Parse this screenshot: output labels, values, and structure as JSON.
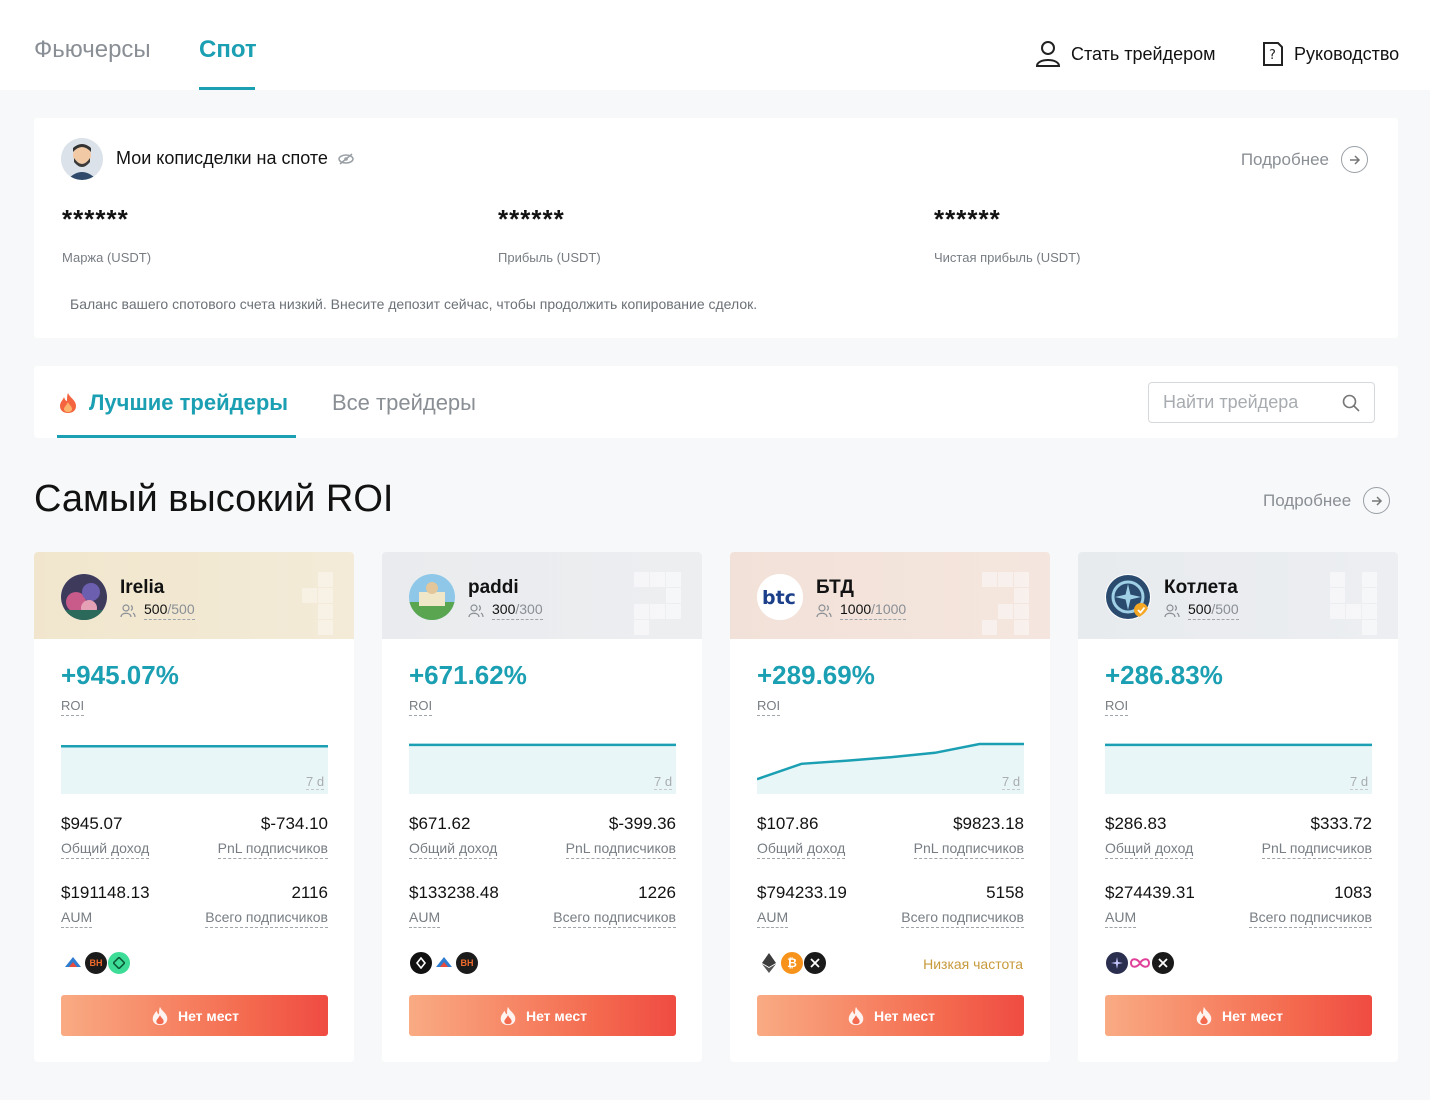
{
  "nav": {
    "tabs": [
      {
        "label": "Фьючерсы"
      },
      {
        "label": "Спот"
      }
    ],
    "become_trader": "Стать трейдером",
    "guide": "Руководство"
  },
  "overview": {
    "title": "Мои копиcделки на споте",
    "more": "Подробнее",
    "stats": [
      {
        "value": "******",
        "label": "Маржа (USDT)"
      },
      {
        "value": "******",
        "label": "Прибыль (USDT)"
      },
      {
        "value": "******",
        "label": "Чистая прибыль (USDT)"
      }
    ],
    "notice": "Баланс вашего спотового счета низкий. Внесите депозит сейчас, чтобы продолжить копирование сделок."
  },
  "tabs": {
    "best": "Лучшие трейдеры",
    "all": "Все трейдеры",
    "search_placeholder": "Найти трейдера"
  },
  "section": {
    "title": "Самый высокий ROI",
    "more": "Подробнее"
  },
  "labels": {
    "roi": "ROI",
    "period": "7 d",
    "total_income": "Общий доход",
    "follower_pnl": "PnL подписчиков",
    "aum": "AUM",
    "total_followers": "Всего подписчиков",
    "no_slots": "Нет мест"
  },
  "traders": [
    {
      "name": "Irelia",
      "slots_used": "500",
      "slots_total": "/500",
      "roi": "+945.07%",
      "total_income": "$945.07",
      "follower_pnl": "$-734.10",
      "aum": "$191148.13",
      "followers": "2116",
      "frequency": "",
      "coins": [
        "arrow-coin-icon",
        "bh-coin-icon",
        "green-coin-icon"
      ],
      "roi_series": [
        0.95,
        0.95,
        0.95,
        0.95,
        0.95,
        0.95,
        0.95
      ]
    },
    {
      "name": "paddi",
      "slots_used": "300",
      "slots_total": "/300",
      "roi": "+671.62%",
      "total_income": "$671.62",
      "follower_pnl": "$-399.36",
      "aum": "$133238.48",
      "followers": "1226",
      "frequency": "",
      "coins": [
        "black-coin-icon",
        "arrow-coin-icon",
        "bh-coin-icon"
      ],
      "roi_series": [
        0.98,
        0.98,
        0.98,
        0.98,
        0.98,
        0.98,
        0.98
      ]
    },
    {
      "name": "БТД",
      "slots_used": "1000",
      "slots_total": "/1000",
      "roi": "+289.69%",
      "total_income": "$107.86",
      "follower_pnl": "$9823.18",
      "aum": "$794233.19",
      "followers": "5158",
      "frequency": "Низкая частота",
      "coins": [
        "eth-coin-icon",
        "btc-coin-icon",
        "x-coin-icon"
      ],
      "roi_series": [
        0.2,
        0.55,
        0.62,
        0.7,
        0.8,
        1.0,
        1.0
      ]
    },
    {
      "name": "Котлета",
      "slots_used": "500",
      "slots_total": "/500",
      "roi": "+286.83%",
      "total_income": "$286.83",
      "follower_pnl": "$333.72",
      "aum": "$274439.31",
      "followers": "1083",
      "frequency": "",
      "coins": [
        "star-coin-icon",
        "infinity-coin-icon",
        "x-coin-icon"
      ],
      "roi_series": [
        0.98,
        0.98,
        0.98,
        0.98,
        0.98,
        0.98,
        0.98
      ]
    }
  ],
  "colors": {
    "accent": "#1b9fb2",
    "button_start": "#f9ab83",
    "button_end": "#ef4b42",
    "frequency": "#c79a3c"
  }
}
